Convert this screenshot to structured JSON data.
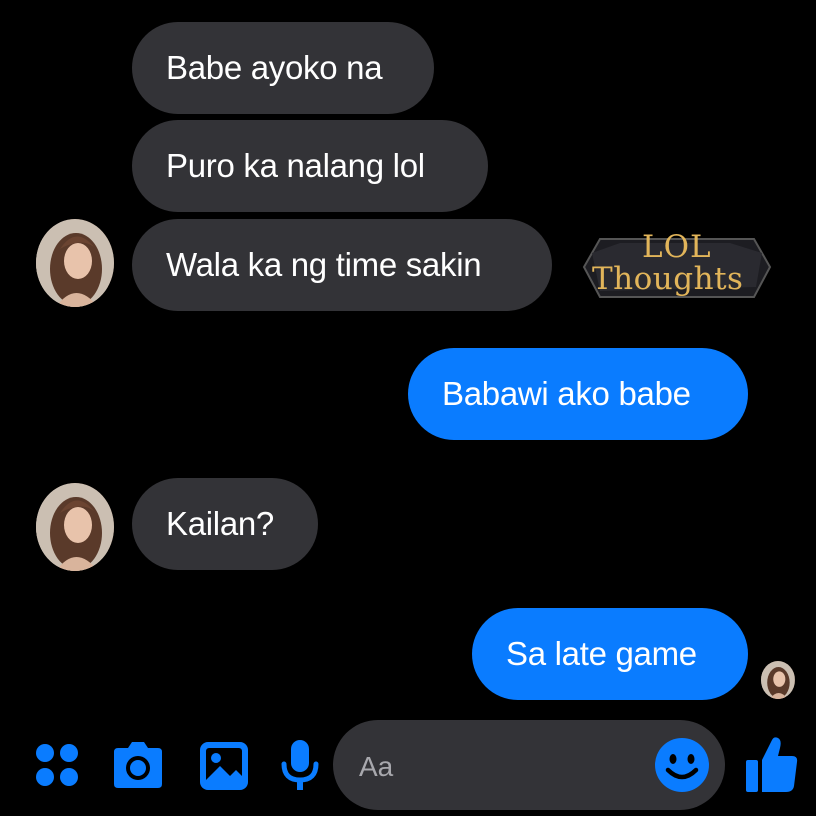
{
  "conversation": {
    "messages": [
      {
        "sender": "contact",
        "text": "Babe ayoko na"
      },
      {
        "sender": "contact",
        "text": "Puro ka nalang lol"
      },
      {
        "sender": "contact",
        "text": "Wala ka ng time sakin"
      },
      {
        "sender": "me",
        "text": "Babawi ako babe"
      },
      {
        "sender": "contact",
        "text": "Kailan?"
      },
      {
        "sender": "me",
        "text": "Sa late game"
      }
    ]
  },
  "watermark": {
    "line1": "LOL",
    "line2": "Thoughts"
  },
  "composer": {
    "placeholder": "Aa",
    "icons": [
      "menu-dots-icon",
      "camera-icon",
      "image-icon",
      "microphone-icon",
      "emoji-icon",
      "thumbs-up-icon"
    ]
  },
  "colors": {
    "background": "#000000",
    "incoming_bubble": "#333337",
    "outgoing_bubble": "#0a7cff",
    "accent": "#0a7cff"
  }
}
